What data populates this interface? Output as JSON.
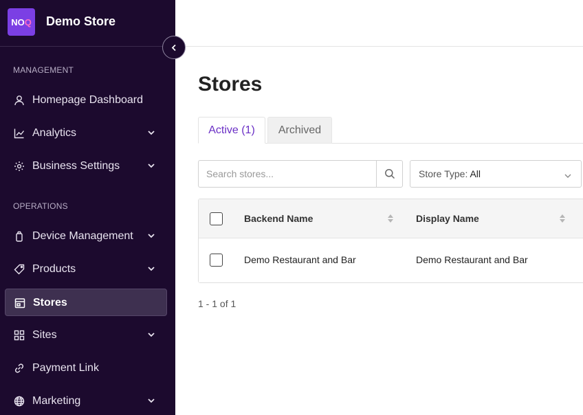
{
  "brand": {
    "logo_text": "NOQ",
    "store_name": "Demo Store"
  },
  "sidebar": {
    "sections": [
      {
        "label": "MANAGEMENT"
      },
      {
        "label": "OPERATIONS"
      }
    ],
    "items": [
      {
        "label": "Homepage Dashboard",
        "icon": "user-icon",
        "expandable": false
      },
      {
        "label": "Analytics",
        "icon": "chart-icon",
        "expandable": true
      },
      {
        "label": "Business Settings",
        "icon": "gear-icon",
        "expandable": true
      },
      {
        "label": "Device Management",
        "icon": "device-icon",
        "expandable": true
      },
      {
        "label": "Products",
        "icon": "tag-icon",
        "expandable": true
      },
      {
        "label": "Stores",
        "icon": "store-icon",
        "expandable": false,
        "active": true
      },
      {
        "label": "Sites",
        "icon": "grid-icon",
        "expandable": true
      },
      {
        "label": "Payment Link",
        "icon": "link-icon",
        "expandable": false
      },
      {
        "label": "Marketing",
        "icon": "globe-icon",
        "expandable": true
      }
    ]
  },
  "main": {
    "title": "Stores",
    "tabs": [
      {
        "label": "Active (1)",
        "active": true
      },
      {
        "label": "Archived",
        "active": false
      }
    ],
    "search": {
      "placeholder": "Search stores..."
    },
    "filter": {
      "label": "Store Type:",
      "value": "All"
    },
    "table": {
      "columns": [
        "Backend Name",
        "Display Name"
      ],
      "rows": [
        [
          "Demo Restaurant and Bar",
          "Demo Restaurant and Bar"
        ]
      ]
    },
    "pagination": "1 - 1 of 1"
  },
  "colors": {
    "sidebar_bg": "#1c0a2e",
    "accent": "#6a2fc5",
    "logo_bg": "#7b3fe4"
  }
}
